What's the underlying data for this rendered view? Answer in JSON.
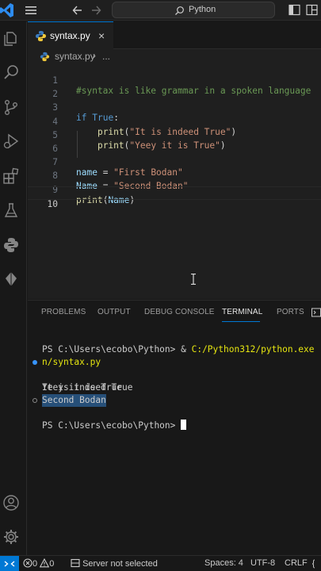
{
  "titlebar": {
    "search_placeholder": "Python"
  },
  "activity_bar": {
    "items": [
      "explorer",
      "search",
      "source-control",
      "run-and-debug",
      "extensions",
      "testing",
      "python",
      "remote"
    ],
    "bottom": [
      "accounts",
      "manage"
    ]
  },
  "editor": {
    "tab": {
      "filename": "syntax.py",
      "close_glyph": "×"
    },
    "breadcrumb": {
      "file": "syntax.py",
      "separator": "›",
      "rest": "..."
    },
    "line_numbers": [
      "1",
      "2",
      "3",
      "4",
      "5",
      "6",
      "7",
      "8",
      "9",
      "10"
    ],
    "code": {
      "l1": "#syntax is like grammar in a spoken language",
      "l3_kw": "if",
      "l3_cond": "True",
      "l3_colon": ":",
      "l4_fn": "print",
      "l4_open": "(",
      "l4_str": "\"It is indeed True\"",
      "l4_close": ")",
      "l5_fn": "print",
      "l5_open": "(",
      "l5_str": "\"Yeey it is True\"",
      "l5_close": ")",
      "l7_var": "name",
      "l7_eq": " = ",
      "l7_str": "\"First Bodan\"",
      "l8_var": "Name",
      "l8_eq": " = ",
      "l8_str": "\"Second Bodan\"",
      "l9_fn": "print",
      "l9_open": "(",
      "l9_arg": "Name",
      "l9_close": ")"
    }
  },
  "panel": {
    "tabs": [
      "PROBLEMS",
      "OUTPUT",
      "DEBUG CONSOLE",
      "TERMINAL",
      "PORTS"
    ],
    "active_tab": "TERMINAL",
    "terminal": {
      "prompt1": "PS C:\\Users\\ecobo\\Python> & ",
      "cmd_path_a": "C:/Python312/python.exe",
      "cmd_path_b": "n/syntax.py",
      "out1": "It is indeed True",
      "out2": "Yeey it is True",
      "out3": "Second Bodan",
      "prompt2": "PS C:\\Users\\ecobo\\Python> "
    }
  },
  "statusbar": {
    "errors": "0",
    "warnings": "0",
    "interpreter": "Server not selected",
    "indent": "Spaces: 4",
    "encoding": "UTF-8",
    "eol": "CRLF"
  },
  "colors": {
    "accent": "#0078d4",
    "keyword": "#569cd6",
    "function": "#dcdcaa",
    "string": "#ce9178",
    "comment": "#6a9955",
    "variable": "#9cdcfe",
    "terminal_path": "#e5e510"
  }
}
